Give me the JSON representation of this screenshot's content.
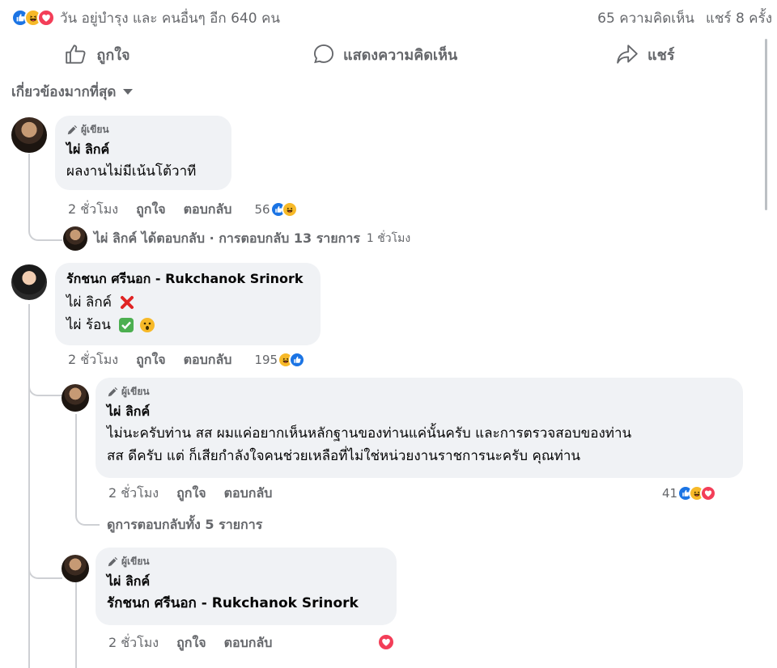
{
  "summary": {
    "reactions": [
      "like-icon",
      "haha-icon",
      "love-icon"
    ],
    "text": "วัน อยู่บำรุง และ คนอื่นๆ อีก 640 คน",
    "comments": "65 ความคิดเห็น",
    "shares": "แชร์ 8 ครั้ง"
  },
  "actions": {
    "like": "ถูกใจ",
    "comment": "แสดงความคิดเห็น",
    "share": "แชร์"
  },
  "filter": {
    "label": "เกี่ยวข้องมากที่สุด"
  },
  "author_badge": "ผู้เขียน",
  "comments": [
    {
      "name": "ไผ่ ลิกค์",
      "text": "ผลงานไม่มีเน้นโต้วาที",
      "time": "2 ชั่วโมง",
      "like": "ถูกใจ",
      "reply": "ตอบกลับ",
      "reaction_count": "56",
      "reply_summary": {
        "name_text": "ไผ่ ลิกค์ ได้ตอบกลับ · การตอบกลับ 13 รายการ",
        "time": "1 ชั่วโมง"
      }
    },
    {
      "name": "รักชนก ศรีนอก - Rukchanok Srinork",
      "line1": "ไผ่ ลิกค์",
      "line2": "ไผ่ ร้อน",
      "time": "2 ชั่วโมง",
      "like": "ถูกใจ",
      "reply": "ตอบกลับ",
      "reaction_count": "195",
      "replies": [
        {
          "name": "ไผ่ ลิกค์",
          "line1": "ไม่นะครับท่าน สส ผมแค่อยากเห็นหลักฐานของท่านแค่นั้นครับ และการตรวจสอบของท่าน",
          "line2": "สส ดีครับ แต่ ก็เสียกำลังใจคนช่วยเหลือที่ไม่ใช่หน่วยงานราชการนะครับ คุณท่าน",
          "time": "2 ชั่วโมง",
          "like": "ถูกใจ",
          "reply": "ตอบกลับ",
          "reaction_count": "41",
          "view_replies": "ดูการตอบกลับทั้ง 5 รายการ"
        },
        {
          "name": "ไผ่ ลิกค์",
          "text": "รักชนก ศรีนอก - Rukchanok Srinork",
          "time": "2 ชั่วโมง",
          "like": "ถูกใจ",
          "reply": "ตอบกลับ"
        }
      ]
    }
  ],
  "colors": {
    "like": "#1b74e4",
    "haha": "#f7b928",
    "love": "#f33e58",
    "secondary_text": "#65676b",
    "bubble": "#f0f2f5"
  }
}
